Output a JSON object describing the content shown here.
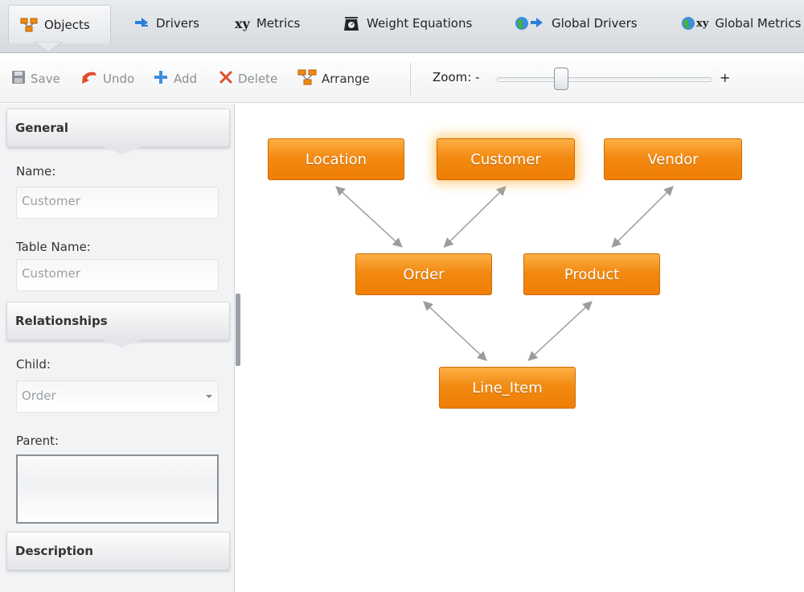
{
  "tabs": [
    {
      "label": "Objects",
      "icon": "objects-icon"
    },
    {
      "label": "Drivers",
      "icon": "drivers-icon"
    },
    {
      "label": "Metrics",
      "icon": "xy-metrics-icon"
    },
    {
      "label": "Weight Equations",
      "icon": "scale-icon"
    },
    {
      "label": "Global Drivers",
      "icon": "globe-drivers-icon"
    },
    {
      "label": "Global Metrics",
      "icon": "globe-xy-icon"
    }
  ],
  "metrics_icon_text": "xy",
  "toolbar": {
    "save": "Save",
    "undo": "Undo",
    "add": "Add",
    "delete": "Delete",
    "arrange": "Arrange",
    "zoom_label": "Zoom: -",
    "zoom_plus": "+",
    "zoom_level_fraction": 0.3
  },
  "sidebar": {
    "general": {
      "header": "General",
      "name_label": "Name:",
      "name_value": "Customer",
      "table_label": "Table Name:",
      "table_value": "Customer"
    },
    "relationships": {
      "header": "Relationships",
      "child_label": "Child:",
      "child_value": "Order",
      "parent_label": "Parent:"
    },
    "description": {
      "header": "Description"
    }
  },
  "diagram": {
    "nodes": [
      {
        "id": "location",
        "label": "Location"
      },
      {
        "id": "customer",
        "label": "Customer",
        "selected": true
      },
      {
        "id": "vendor",
        "label": "Vendor"
      },
      {
        "id": "order",
        "label": "Order"
      },
      {
        "id": "product",
        "label": "Product"
      },
      {
        "id": "line_item",
        "label": "Line_Item"
      }
    ],
    "links": [
      [
        "location",
        "order"
      ],
      [
        "customer",
        "order"
      ],
      [
        "vendor",
        "product"
      ],
      [
        "order",
        "line_item"
      ],
      [
        "product",
        "line_item"
      ]
    ],
    "node_color": "#f28a12",
    "link_color": "#9c9c9c"
  }
}
